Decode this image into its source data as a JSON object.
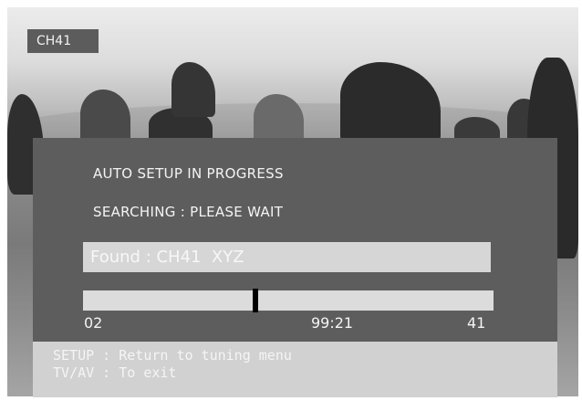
{
  "channel_badge": "CH41",
  "setup": {
    "title": "AUTO SETUP IN PROGRESS",
    "status": "SEARCHING : PLEASE WAIT",
    "found_label": "Found : CH41  XYZ",
    "progress": {
      "fraction": 0.42,
      "left_value": "02",
      "middle_value": "99:21",
      "right_value": "41"
    },
    "help_lines": [
      "SETUP : Return to tuning menu",
      "TV/AV : To exit"
    ]
  },
  "colors": {
    "panel": "#5d5d5d",
    "found_bar": "#d6d6d6",
    "progress_track": "#dcdcdc",
    "marker": "#000000",
    "help_bar": "#d1d1d1"
  }
}
